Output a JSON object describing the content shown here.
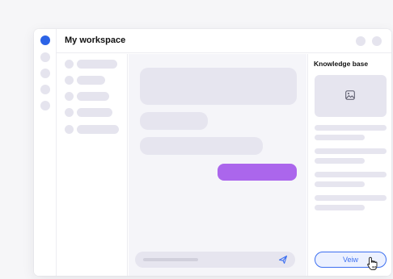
{
  "window": {
    "title": "My workspace"
  },
  "rail": {
    "icons": [
      "workspace-icon",
      "nav-dot-icon",
      "nav-dot-icon",
      "nav-dot-icon",
      "nav-dot-icon"
    ]
  },
  "header": {
    "buttons": [
      "window-control-1",
      "window-control-2"
    ]
  },
  "sidebar": {
    "items": [
      "placeholder",
      "placeholder",
      "placeholder",
      "placeholder",
      "placeholder"
    ]
  },
  "chat": {
    "send_icon": "send-icon"
  },
  "knowledge": {
    "title": "Knowledge base",
    "image_icon": "image-icon",
    "view_label": "Veiw"
  },
  "colors": {
    "accent": "#2c63e6",
    "user_bubble": "#ab66ec",
    "placeholder": "#e5e4ee",
    "button_border": "#3c6ff0"
  }
}
